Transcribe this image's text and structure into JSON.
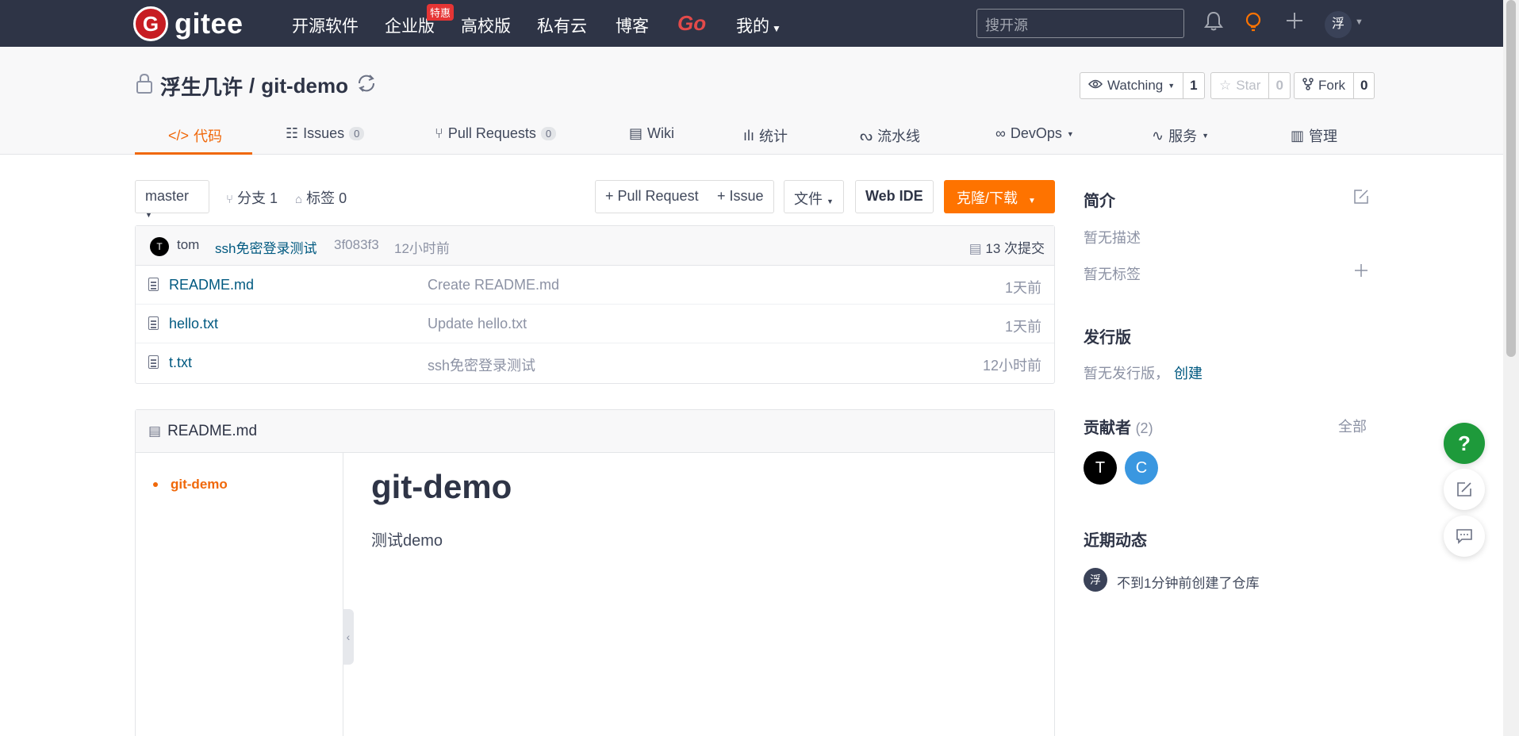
{
  "topnav": {
    "logo_text": "gitee",
    "logo_mark": "G",
    "items": [
      "开源软件",
      "企业版",
      "高校版",
      "私有云",
      "博客",
      "Go",
      "我的"
    ],
    "hot_badge": "特惠",
    "search_placeholder": "搜开源",
    "user_avatar": "浮"
  },
  "repo": {
    "owner": "浮生几许",
    "separator": "/",
    "name": "git-demo",
    "watch_label": "Watching",
    "watch_count": "1",
    "star_label": "Star",
    "star_count": "0",
    "fork_label": "Fork",
    "fork_count": "0"
  },
  "tabs": {
    "code": "代码",
    "issues": "Issues",
    "issues_count": "0",
    "pulls": "Pull Requests",
    "pulls_count": "0",
    "wiki": "Wiki",
    "stats": "统计",
    "pipeline": "流水线",
    "devops": "DevOps",
    "service": "服务",
    "manage": "管理"
  },
  "toolbar": {
    "branch": "master",
    "branches": "分支 1",
    "tags": "标签 0",
    "pull_request": "+ Pull Request",
    "issue": "+ Issue",
    "file": "文件",
    "web_ide": "Web IDE",
    "clone": "克隆/下载"
  },
  "commit": {
    "avatar": "T",
    "author": "tom",
    "message": "ssh免密登录测试",
    "hash": "3f083f3",
    "time": "12小时前",
    "count": "13 次提交"
  },
  "files": [
    {
      "name": "README.md",
      "message": "Create README.md",
      "time": "1天前"
    },
    {
      "name": "hello.txt",
      "message": "Update hello.txt",
      "time": "1天前"
    },
    {
      "name": "t.txt",
      "message": "ssh免密登录测试",
      "time": "12小时前"
    }
  ],
  "readme": {
    "filename": "README.md",
    "toc_item": "git-demo",
    "heading": "git-demo",
    "body": "测试demo"
  },
  "sidebar": {
    "intro_title": "简介",
    "no_desc": "暂无描述",
    "no_tags": "暂无标签",
    "release_title": "发行版",
    "no_release": "暂无发行版，",
    "create_link": "创建",
    "contrib_title": "贡献者",
    "contrib_count": "(2)",
    "all_link": "全部",
    "contributors": [
      {
        "initial": "T",
        "color": "#000000"
      },
      {
        "initial": "C",
        "color": "#3a97e0"
      }
    ],
    "activity_title": "近期动态",
    "activity_avatar": "浮",
    "activity_text": "不到1分钟前创建了仓库"
  },
  "floating": {
    "help": "?"
  },
  "colors": {
    "accent": "#fe7300",
    "nav_bg": "#2e3446",
    "link": "#005980"
  }
}
